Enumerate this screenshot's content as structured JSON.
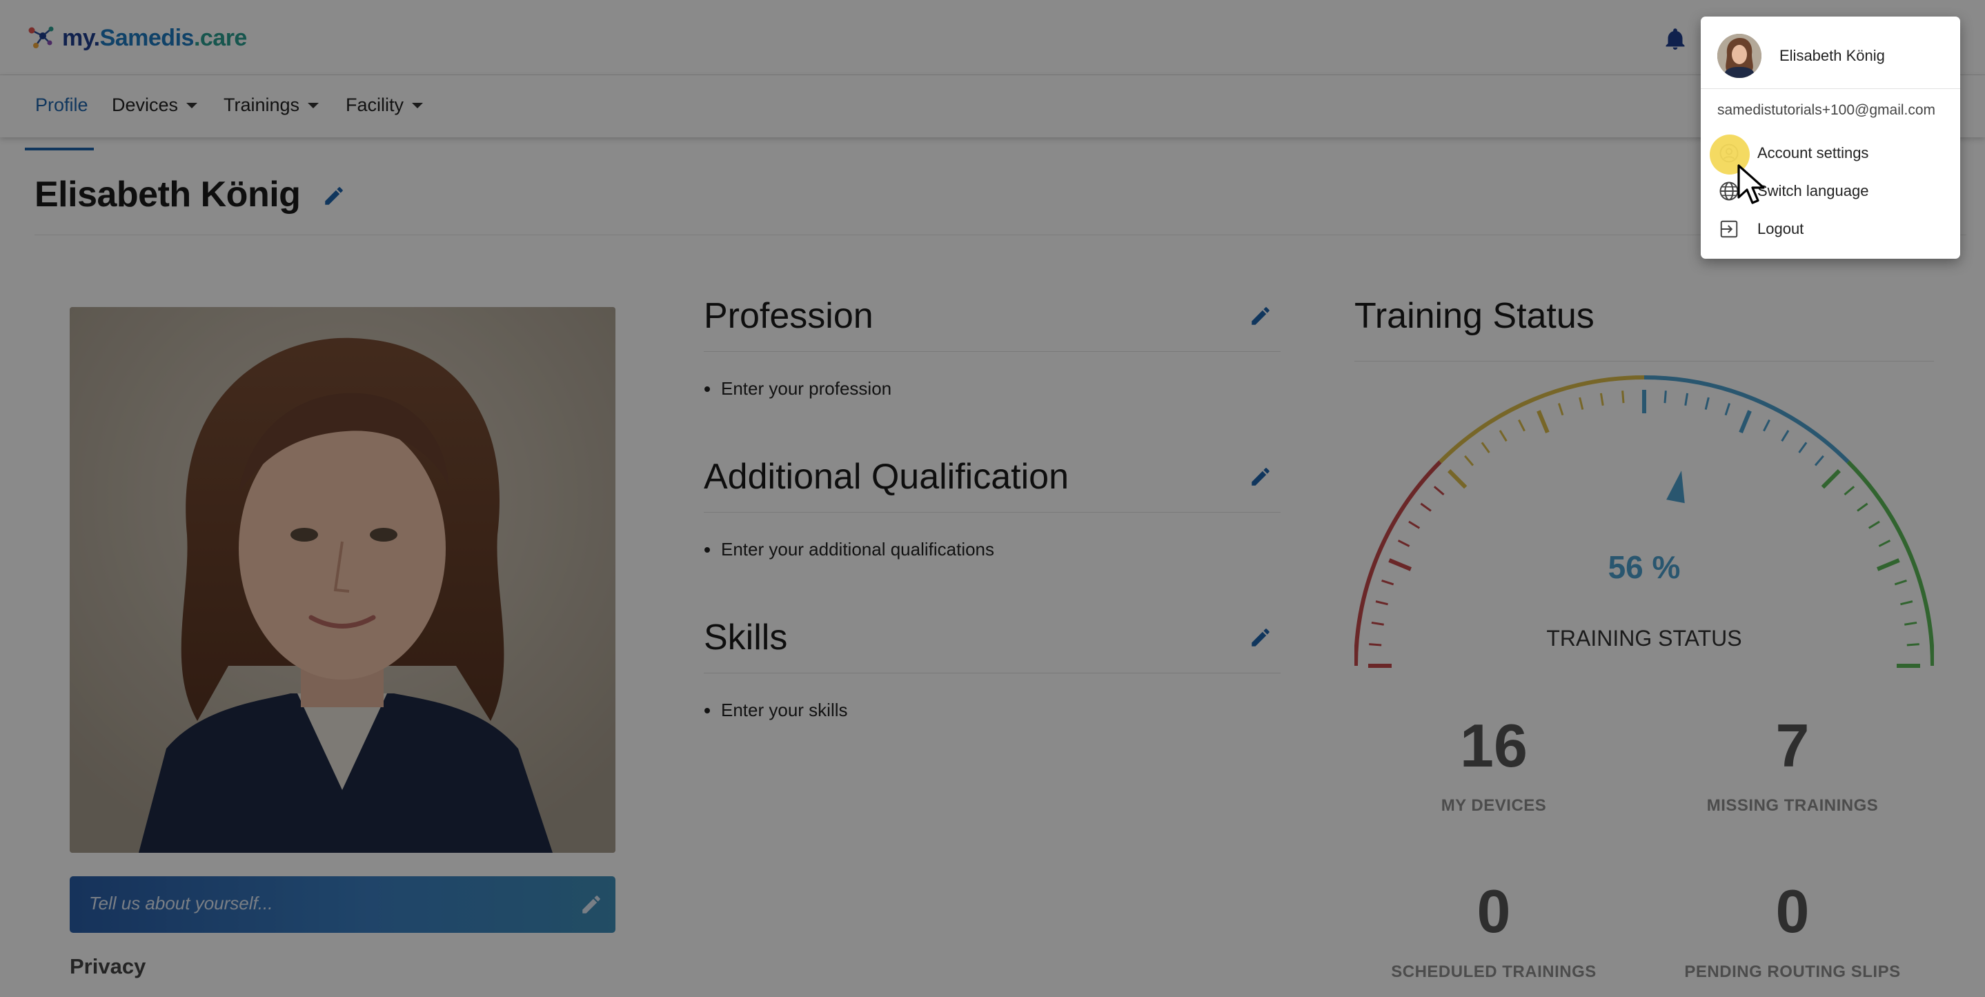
{
  "app": {
    "logo_text_1": "my.",
    "logo_text_2": "Samedis",
    "logo_text_3": ".care"
  },
  "nav": {
    "items": [
      {
        "label": "Profile",
        "active": true
      },
      {
        "label": "Devices",
        "dropdown": true
      },
      {
        "label": "Trainings",
        "dropdown": true
      },
      {
        "label": "Facility",
        "dropdown": true
      }
    ]
  },
  "profile": {
    "name": "Elisabeth König",
    "about_placeholder": "Tell us about yourself...",
    "privacy_label": "Privacy"
  },
  "sections": [
    {
      "title": "Profession",
      "placeholder": "Enter your profession"
    },
    {
      "title": "Additional Qualification",
      "placeholder": "Enter your additional qualifications"
    },
    {
      "title": "Skills",
      "placeholder": "Enter your skills"
    }
  ],
  "training_status": {
    "title": "Training Status",
    "percent_text": "56 %",
    "percent_value": 56,
    "gauge_label": "TRAINING STATUS",
    "stats": [
      {
        "value": "16",
        "label": "MY DEVICES"
      },
      {
        "value": "7",
        "label": "MISSING TRAININGS"
      },
      {
        "value": "0",
        "label": "SCHEDULED TRAININGS"
      },
      {
        "value": "0",
        "label": "PENDING ROUTING SLIPS"
      }
    ],
    "colors": {
      "red": "#c5494a",
      "yellow": "#dcbd4b",
      "blue": "#4d9fce",
      "green": "#5cb957",
      "needle": "#4d9fce",
      "percent": "#4d9fce"
    }
  },
  "user_menu": {
    "name": "Elisabeth König",
    "email": "samedistutorials+100@gmail.com",
    "items": [
      {
        "label": "Account settings",
        "icon": "account-circle-icon"
      },
      {
        "label": "Switch language",
        "icon": "globe-icon"
      },
      {
        "label": "Logout",
        "icon": "logout-icon"
      }
    ]
  },
  "theme": {
    "accent": "#1f64ad",
    "highlight": "#f3d85a"
  }
}
